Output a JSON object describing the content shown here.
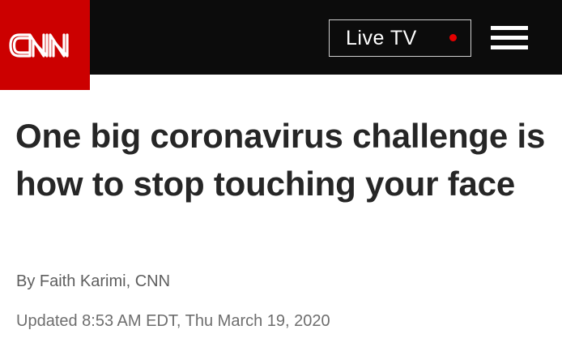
{
  "header": {
    "logo_text": "CNN",
    "live_tv_label": "Live TV",
    "menu_icon": "hamburger-menu-icon",
    "colors": {
      "logo_background": "#cc0000",
      "bar_background": "#0c0c0c",
      "live_dot": "#e40000"
    }
  },
  "article": {
    "headline": "One big coronavirus challenge is how to stop touching your face",
    "byline": "By Faith Karimi, CNN",
    "updated": "Updated 8:53 AM EDT, Thu March 19, 2020"
  }
}
